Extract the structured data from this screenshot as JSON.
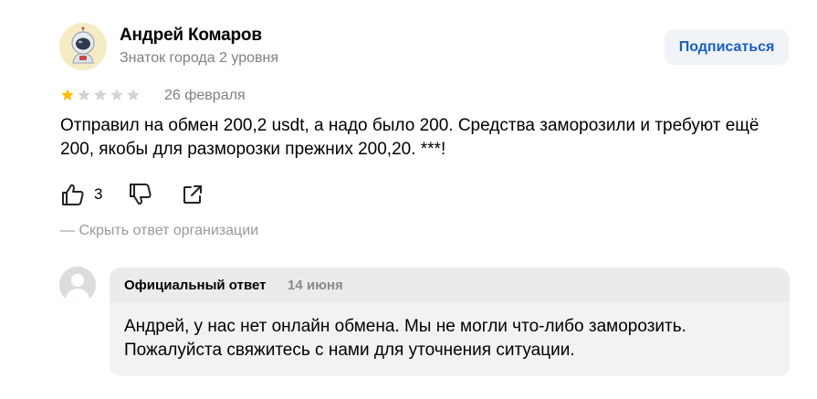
{
  "author": {
    "name": "Андрей Комаров",
    "badge": "Знаток города 2 уровня",
    "avatar_icon": "astronaut-avatar-icon"
  },
  "subscribe_label": "Подписаться",
  "review": {
    "rating": 1,
    "rating_max": 5,
    "date": "26 февраля",
    "text": "Отправил на обмен 200,2 usdt, а надо было 200. Средства заморозили и требуют ещё 200, якобы для разморозки прежних 200,20. ***!"
  },
  "actions": {
    "like_count": "3",
    "like_icon": "thumbs-up-icon",
    "dislike_icon": "thumbs-down-icon",
    "share_icon": "share-icon"
  },
  "toggle_reply_label": "— Скрыть ответ организации",
  "org_reply": {
    "label": "Официальный ответ",
    "date": "14 июня",
    "text": "Андрей, у нас нет онлайн обмена. Мы не могли что-либо заморозить. Пожалуйста свяжитесь с нами для уточнения ситуации.",
    "avatar_icon": "default-user-avatar-icon"
  },
  "colors": {
    "star_filled": "#fcc000",
    "star_empty": "#d3d3d3",
    "link_blue": "#1a60c0",
    "muted_text": "#808080"
  }
}
